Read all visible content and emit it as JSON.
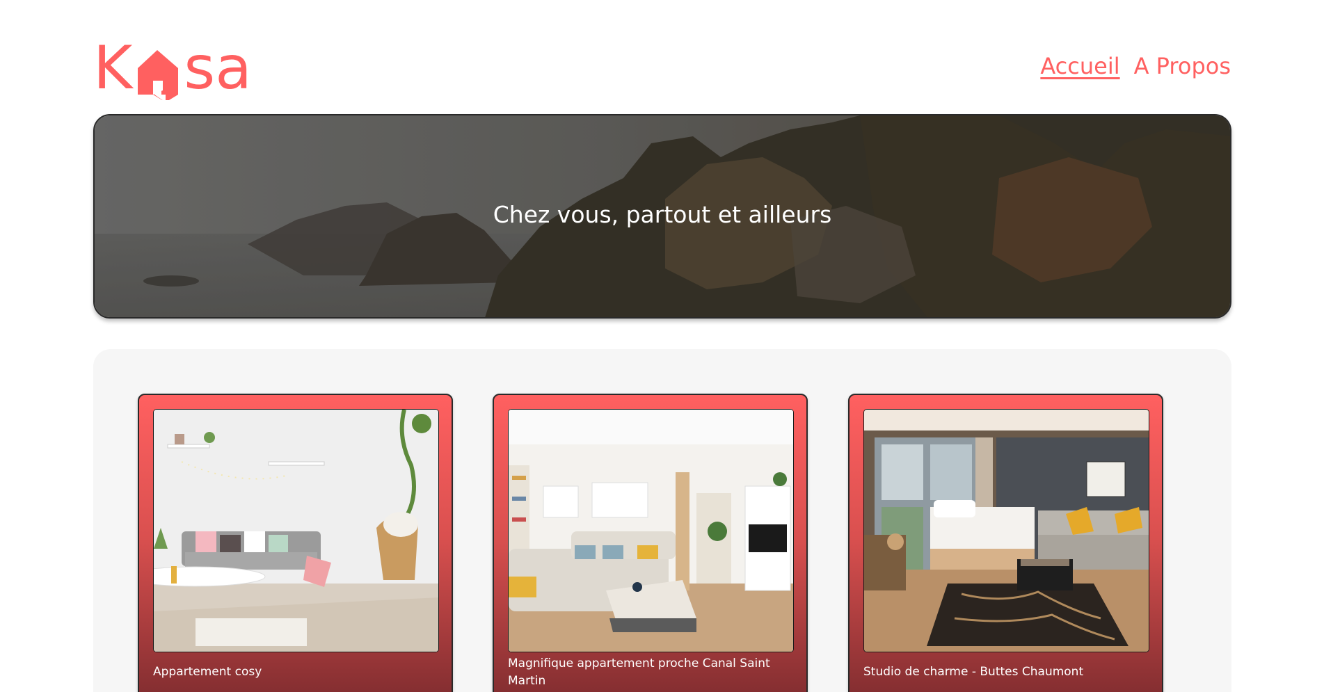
{
  "header": {
    "logo_letters": [
      "K",
      "s",
      "a"
    ],
    "logo_icon": "house-icon",
    "nav": [
      {
        "label": "Accueil",
        "active": true
      },
      {
        "label": "A Propos",
        "active": false
      }
    ]
  },
  "banner": {
    "title": "Chez vous, partout et ailleurs"
  },
  "cards": [
    {
      "title": "Appartement cosy",
      "image": "living-room-photo"
    },
    {
      "title": "Magnifique appartement proche Canal Saint Martin",
      "image": "open-living-room-photo"
    },
    {
      "title": "Studio de charme - Buttes Chaumont",
      "image": "hotel-room-photo"
    }
  ],
  "colors": {
    "brand": "#FF6060",
    "gallery_bg": "#F6F6F6",
    "card_dark": "#7a2a2d"
  }
}
